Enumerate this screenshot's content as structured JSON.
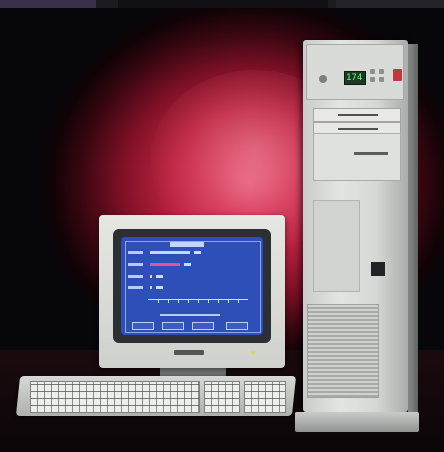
{
  "photo": {
    "subject": "",
    "colors": {
      "backdrop_red": "#d23a5c",
      "dark": "#07060a",
      "case_grey": "#d5d8d5",
      "screen_blue": "#2d4fb7",
      "lcd_green": "#66ff88",
      "lock_red": "#c2363d"
    }
  },
  "tower": {
    "lcd_readout": "174"
  }
}
